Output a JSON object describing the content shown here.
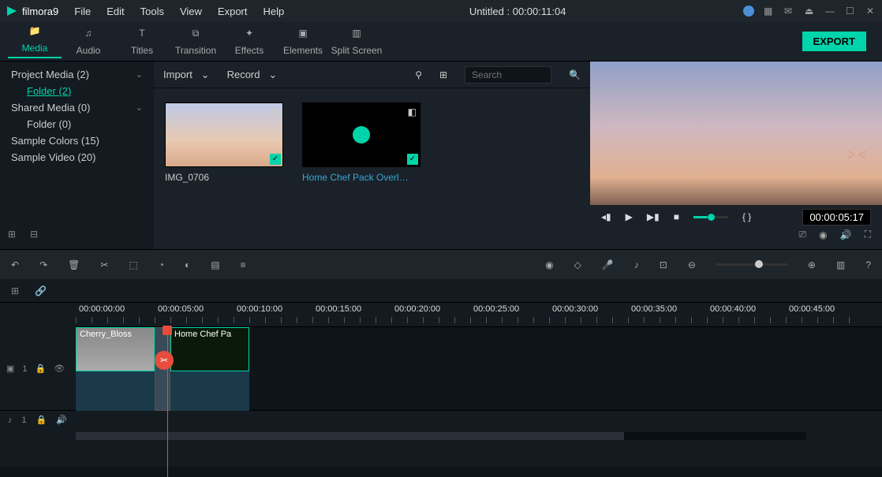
{
  "titlebar": {
    "app_name": "filmora9",
    "menus": [
      "File",
      "Edit",
      "Tools",
      "View",
      "Export",
      "Help"
    ],
    "document_title": "Untitled : 00:00:11:04"
  },
  "topnav": {
    "items": [
      "Media",
      "Audio",
      "Titles",
      "Transition",
      "Effects",
      "Elements",
      "Split Screen"
    ],
    "active_index": 0,
    "export_label": "EXPORT"
  },
  "sidebar": {
    "items": [
      {
        "label": "Project Media (2)",
        "indent": false,
        "expandable": true,
        "selected": false
      },
      {
        "label": "Folder (2)",
        "indent": true,
        "expandable": false,
        "selected": true
      },
      {
        "label": "Shared Media (0)",
        "indent": false,
        "expandable": true,
        "selected": false
      },
      {
        "label": "Folder (0)",
        "indent": true,
        "expandable": false,
        "selected": false
      },
      {
        "label": "Sample Colors (15)",
        "indent": false,
        "expandable": false,
        "selected": false
      },
      {
        "label": "Sample Video (20)",
        "indent": false,
        "expandable": false,
        "selected": false
      }
    ]
  },
  "mediabar": {
    "import_label": "Import",
    "record_label": "Record",
    "search_placeholder": "Search"
  },
  "thumbnails": [
    {
      "label": "IMG_0706",
      "kind": "sky",
      "link": false
    },
    {
      "label": "Home Chef Pack Overl…",
      "kind": "overlay",
      "link": true
    }
  ],
  "preview": {
    "timecode": "00:00:05:17",
    "markers": "{  }"
  },
  "ruler": {
    "labels": [
      "00:00:00:00",
      "00:00:05:00",
      "00:00:10:00",
      "00:00:15:00",
      "00:00:20:00",
      "00:00:25:00",
      "00:00:30:00",
      "00:00:35:00",
      "00:00:40:00",
      "00:00:45:00"
    ]
  },
  "track": {
    "video_label_prefix": "1",
    "clip1_name": "Cherry_Bloss",
    "clip2_name": "Home Chef Pa"
  },
  "audio_track_label": "1"
}
